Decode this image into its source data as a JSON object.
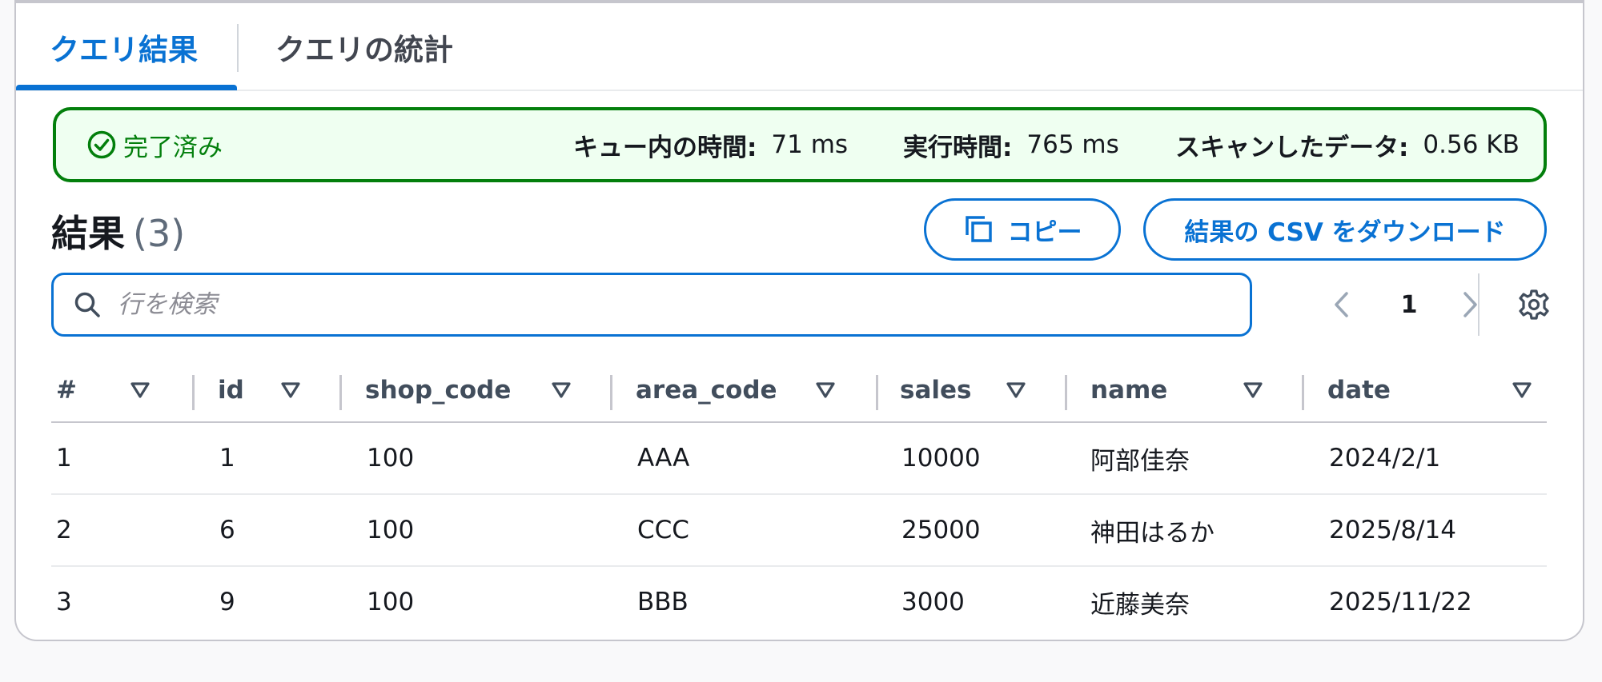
{
  "tabs": [
    {
      "label": "クエリ結果",
      "active": true
    },
    {
      "label": "クエリの統計",
      "active": false
    }
  ],
  "status": {
    "label": "完了済み",
    "stats": [
      {
        "key": "キュー内の時間:",
        "value": "71 ms"
      },
      {
        "key": "実行時間:",
        "value": "765 ms"
      },
      {
        "key": "スキャンしたデータ:",
        "value": "0.56 KB"
      }
    ]
  },
  "results": {
    "title": "結果",
    "count": "(3)",
    "copy_label": "コピー",
    "download_label": "結果の CSV をダウンロード"
  },
  "search": {
    "placeholder": "行を検索",
    "value": ""
  },
  "pagination": {
    "current": "1"
  },
  "table": {
    "columns": [
      "#",
      "id",
      "shop_code",
      "area_code",
      "sales",
      "name",
      "date"
    ],
    "rows": [
      [
        "1",
        "1",
        "100",
        "AAA",
        "10000",
        "阿部佳奈",
        "2024/2/1"
      ],
      [
        "2",
        "6",
        "100",
        "CCC",
        "25000",
        "神田はるか",
        "2025/8/14"
      ],
      [
        "3",
        "9",
        "100",
        "BBB",
        "3000",
        "近藤美奈",
        "2025/11/22"
      ]
    ]
  },
  "colors": {
    "accent": "#0972d3",
    "success": "#037f0c",
    "success_bg": "#effff1"
  }
}
